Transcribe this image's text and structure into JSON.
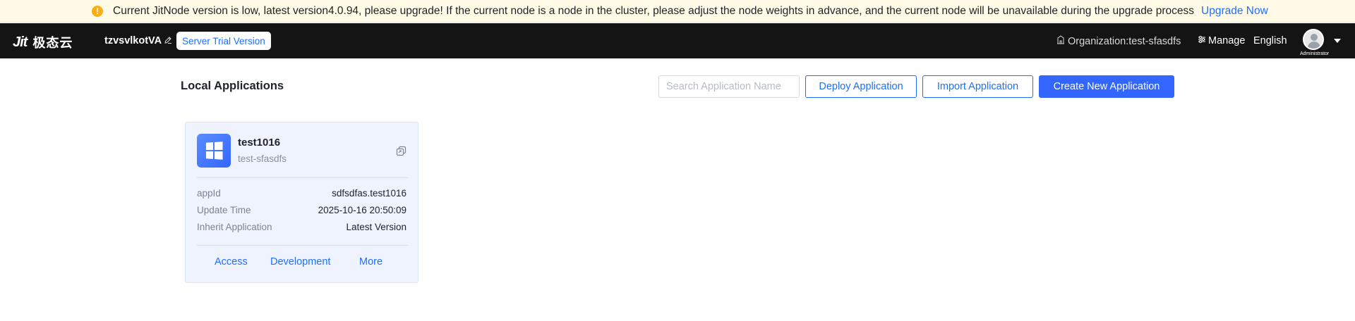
{
  "banner": {
    "message": "Current JitNode version is low, latest version4.0.94, please upgrade! If the current node is a node in the cluster, please adjust the node weights in advance, and the current node will be unavailable during the upgrade process",
    "link_label": "Upgrade Now",
    "icon": "warning-icon",
    "color": "#fffbe6"
  },
  "nav": {
    "logo_mark": "Jit",
    "logo_text": "极态云",
    "org_name": "tzvsvlkotVA",
    "trial_badge": "Server Trial Version",
    "organization": "Organization:test-sfasdfs",
    "manage": "Manage",
    "language": "English",
    "avatar_role": "Administrator",
    "background": "#141414"
  },
  "main": {
    "title": "Local Applications",
    "search_placeholder": "Search Application Name",
    "deploy_button": "Deploy Application",
    "import_button": "Import Application",
    "create_button": "Create New Application",
    "accent": "#3366ff"
  },
  "app_card": {
    "name": "test1016",
    "org": "test-sfasdfs",
    "icon": "windows-icon",
    "fields": [
      {
        "label": "appId",
        "value": "sdfsdfas.test1016"
      },
      {
        "label": "Update Time",
        "value": "2025-10-16 20:50:09"
      },
      {
        "label": "Inherit Application",
        "value": "Latest Version"
      }
    ],
    "actions": [
      "Access",
      "Development",
      "More"
    ]
  }
}
